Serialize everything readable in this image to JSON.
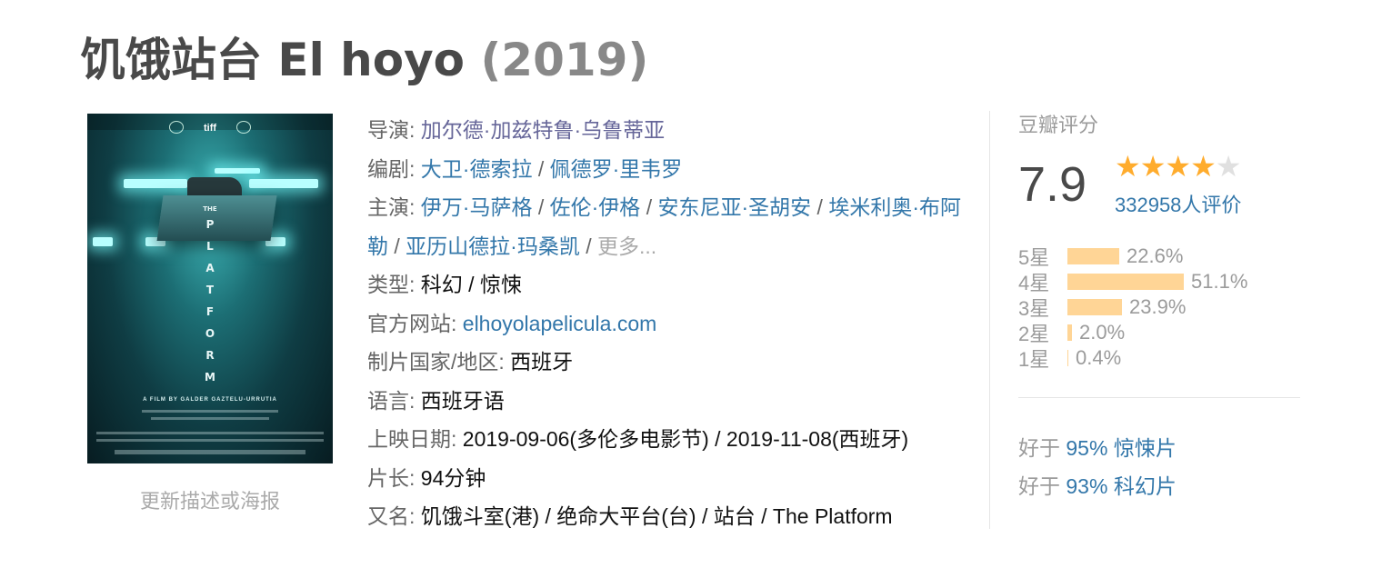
{
  "page": {
    "title_cn": "饥饿站台",
    "title_orig": "El hoyo",
    "year": "(2019)"
  },
  "poster": {
    "text_the": "THE",
    "text_title_letters": [
      "P",
      "L",
      "A",
      "T",
      "F",
      "O",
      "R",
      "M"
    ],
    "credit_line": "A FILM BY GALDER GAZTELU-URRUTIA",
    "tiff": "tiff",
    "update_link": "更新描述或海报"
  },
  "info": {
    "director": {
      "label": "导演:",
      "names": [
        "加尔德·加兹特鲁·乌鲁蒂亚"
      ]
    },
    "writer": {
      "label": "编剧:",
      "names": [
        "大卫·德索拉",
        "佩德罗·里韦罗"
      ]
    },
    "cast": {
      "label": "主演:",
      "names": [
        "伊万·马萨格",
        "佐伦·伊格",
        "安东尼亚·圣胡安",
        "埃米利奥·布阿勒",
        "亚历山德拉·玛桑凯"
      ],
      "more": "更多..."
    },
    "genre": {
      "label": "类型:",
      "value": "科幻 / 惊悚"
    },
    "website": {
      "label": "官方网站:",
      "value": "elhoyolapelicula.com"
    },
    "country": {
      "label": "制片国家/地区:",
      "value": "西班牙"
    },
    "language": {
      "label": "语言:",
      "value": "西班牙语"
    },
    "release": {
      "label": "上映日期:",
      "value": "2019-09-06(多伦多电影节) / 2019-11-08(西班牙)"
    },
    "runtime": {
      "label": "片长:",
      "value": "94分钟"
    },
    "aka": {
      "label": "又名:",
      "value": "饥饿斗室(港) / 绝命大平台(台) / 站台 / The Platform"
    }
  },
  "rating": {
    "label": "豆瓣评分",
    "score": "7.9",
    "stars": 4,
    "votes": "332958人评价",
    "distribution": [
      {
        "star": "5星",
        "percent": "22.6%",
        "value": 22.6
      },
      {
        "star": "4星",
        "percent": "51.1%",
        "value": 51.1
      },
      {
        "star": "3星",
        "percent": "23.9%",
        "value": 23.9
      },
      {
        "star": "2星",
        "percent": "2.0%",
        "value": 2.0
      },
      {
        "star": "1星",
        "percent": "0.4%",
        "value": 0.4
      }
    ],
    "better_than": [
      {
        "prefix": "好于",
        "link": "95% 惊悚片"
      },
      {
        "prefix": "好于",
        "link": "93% 科幻片"
      }
    ]
  },
  "colors": {
    "link": "#3377aa",
    "bar": "#ffd596",
    "star": "#ffac2d"
  }
}
